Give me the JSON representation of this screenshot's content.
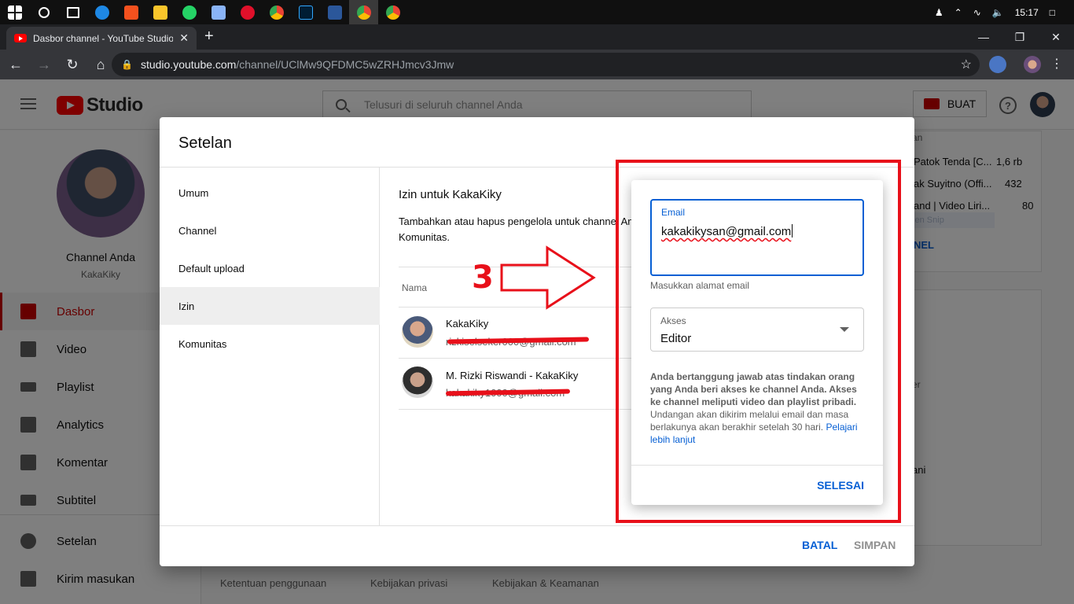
{
  "browser": {
    "tab_title": "Dasbor channel - YouTube Studio",
    "url_host": "studio.youtube.com",
    "url_path": "/channel/UClMw9QFDMC5wZRHJmcv3Jmw",
    "clock": "15:17"
  },
  "header": {
    "logo_text": "Studio",
    "search_placeholder": "Telusuri di seluruh channel Anda",
    "create_label": "BUAT",
    "help_glyph": "?"
  },
  "sidebar": {
    "channel_title": "Channel Anda",
    "channel_name": "KakaKiky",
    "items": [
      {
        "label": "Dasbor",
        "icon": "dashboard-icon",
        "active": true
      },
      {
        "label": "Video",
        "icon": "video-icon"
      },
      {
        "label": "Playlist",
        "icon": "playlist-icon"
      },
      {
        "label": "Analytics",
        "icon": "analytics-icon"
      },
      {
        "label": "Komentar",
        "icon": "comment-icon"
      },
      {
        "label": "Subtitel",
        "icon": "subtitle-icon"
      },
      {
        "label": "Setelan",
        "icon": "gear-icon"
      },
      {
        "label": "Kirim masukan",
        "icon": "feedback-icon"
      }
    ]
  },
  "background": {
    "rows": [
      {
        "title": "Patok Tenda [C...",
        "views": "1,6 rb"
      },
      {
        "title": "ak Suyitno (Offi...",
        "views": "432"
      },
      {
        "title": "and | Video Liri...",
        "views": "80"
      }
    ],
    "link_fragment": "NEL",
    "snip_label": "Fullscreen Snip",
    "fragment_1": "er",
    "fragment_2": "ani",
    "fragment_top": "an",
    "footer": [
      "Ketentuan penggunaan",
      "Kebijakan privasi",
      "Kebijakan & Keamanan"
    ]
  },
  "modal": {
    "title": "Setelan",
    "nav": [
      "Umum",
      "Channel",
      "Default upload",
      "Izin",
      "Komunitas"
    ],
    "active_nav": "Izin",
    "perm_title": "Izin untuk KakaKiky",
    "perm_desc": "Tambahkan atau hapus pengelola untuk channel An Komunitas.",
    "col_name": "Nama",
    "people": [
      {
        "name": "KakaKiky",
        "email": "rizkiselseker000@gmail.com"
      },
      {
        "name": "M. Rizki Riswandi - KakaKiky",
        "email": "kakakiky1000@gmail.com"
      }
    ],
    "cancel_label": "BATAL",
    "save_label": "SIMPAN"
  },
  "annotation": {
    "step_number": "3",
    "color": "#e8101a"
  },
  "invite": {
    "email_label": "Email",
    "email_value": "kakakikysan@gmail.com",
    "email_hint": "Masukkan alamat email",
    "access_label": "Akses",
    "access_value": "Editor",
    "note_bold": "Anda bertanggung jawab atas tindakan orang yang Anda beri akses ke channel Anda. Akses ke channel meliputi video dan playlist pribadi.",
    "note_plain": " Undangan akan dikirim melalui email dan masa berlakunya akan berakhir setelah 30 hari. ",
    "note_link": "Pelajari lebih lanjut",
    "done_label": "SELESAI"
  },
  "colors": {
    "accent": "#065fd4",
    "brand_red": "#ff0000",
    "active_red": "#cc0000"
  }
}
